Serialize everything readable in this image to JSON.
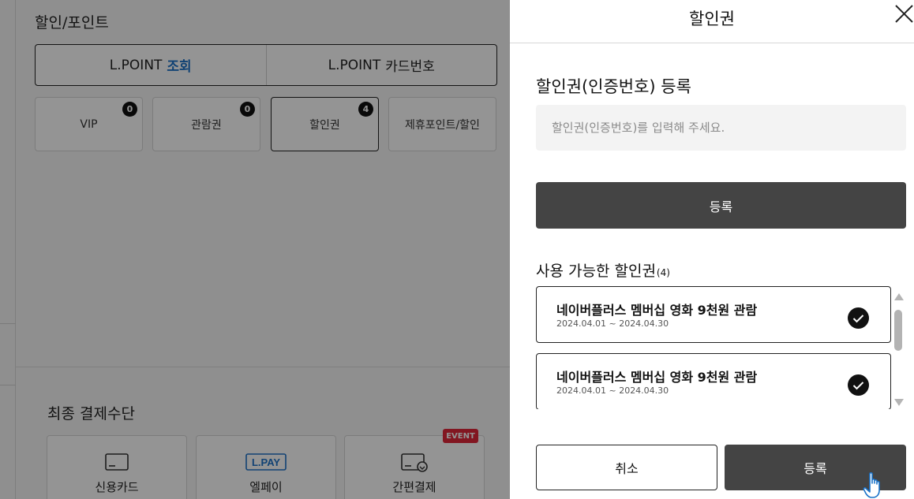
{
  "background": {
    "section_title": "할인/포인트",
    "lpoint_tabs": [
      {
        "prefix": "L.POINT",
        "label": "조회"
      },
      {
        "prefix": "L.POINT",
        "label": "카드번호"
      }
    ],
    "discount_cards": [
      {
        "label": "VIP",
        "count": "0"
      },
      {
        "label": "관람권",
        "count": "0"
      },
      {
        "label": "할인권",
        "count": "4"
      },
      {
        "label": "제휴포인트/할인",
        "count": ""
      }
    ],
    "payment_title": "최종 결제수단",
    "payment_methods": [
      {
        "label": "신용카드",
        "icon": "credit-card-icon"
      },
      {
        "label": "엘페이",
        "icon": "lpay-logo",
        "logo_text": "L.PAY"
      },
      {
        "label": "간편결제",
        "icon": "simple-pay-icon"
      }
    ],
    "event_tag": "EVENT"
  },
  "modal": {
    "title": "할인권",
    "close_icon": "close-icon",
    "register_title": "할인권(인증번호) 등록",
    "input_placeholder": "할인권(인증번호)를 입력해 주세요.",
    "input_value": "",
    "register_button": "등록",
    "available_title": "사용 가능한 할인권",
    "available_count": "(4)",
    "coupons": [
      {
        "name": "네이버플러스 멤버십 영화 9천원 관람",
        "period": "2024.04.01 ~ 2024.04.30",
        "checked": true
      },
      {
        "name": "네이버플러스 멤버십 영화 9천원 관람",
        "period": "2024.04.01 ~ 2024.04.30",
        "checked": true
      }
    ],
    "cancel_button": "취소",
    "confirm_button": "등록"
  },
  "colors": {
    "accent_blue": "#1e73c8",
    "dark_button": "#444444",
    "event_red": "#e0263a",
    "overlay": "rgba(0,0,0,0.42)"
  }
}
